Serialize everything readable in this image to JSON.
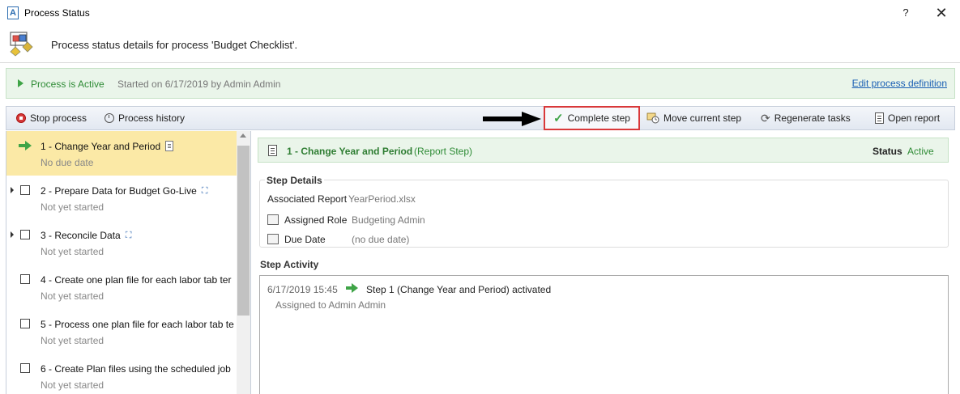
{
  "window": {
    "title": "Process Status",
    "app_icon_letter": "A",
    "help_label": "?",
    "close_label": "✕"
  },
  "header": {
    "description": "Process status details for process 'Budget Checklist'."
  },
  "status_bar": {
    "state_label": "Process is Active",
    "started_text": "Started on 6/17/2019 by Admin Admin",
    "edit_link": "Edit process definition",
    "accent_color": "#2e8b35"
  },
  "toolbar": {
    "stop_label": "Stop process",
    "history_label": "Process history",
    "complete_label": "Complete step",
    "move_label": "Move current step",
    "regenerate_label": "Regenerate tasks",
    "open_report_label": "Open report",
    "highlight_color": "#d9383a"
  },
  "steps": [
    {
      "title": "1 - Change Year and Period",
      "subtitle": "No due date",
      "icon": "document-icon",
      "selected": true
    },
    {
      "title": "2 - Prepare Data for Budget Go-Live",
      "subtitle": "Not yet started",
      "icon": "hierarchy-icon",
      "selected": false
    },
    {
      "title": "3 - Reconcile Data",
      "subtitle": "Not yet started",
      "icon": "hierarchy-icon",
      "selected": false
    },
    {
      "title": "4 - Create one plan file for each labor tab ter",
      "subtitle": "Not yet started",
      "icon": "",
      "selected": false
    },
    {
      "title": "5 - Process one plan file for each labor tab te",
      "subtitle": "Not yet started",
      "icon": "",
      "selected": false
    },
    {
      "title": "6 - Create Plan files using the scheduled job",
      "subtitle": "Not yet started",
      "icon": "",
      "selected": false
    }
  ],
  "step_header": {
    "title": "1 - Change Year and Period",
    "type": "(Report Step)",
    "status_label": "Status",
    "status_value": "Active"
  },
  "details": {
    "section_title": "Step Details",
    "report_label": "Associated Report",
    "report_value": "YearPeriod.xlsx",
    "role_label": "Assigned Role",
    "role_value": "Budgeting Admin",
    "due_label": "Due Date",
    "due_value": "(no due date)"
  },
  "activity": {
    "section_title": "Step Activity",
    "entries": [
      {
        "time": "6/17/2019 15:45",
        "text": "Step 1 (Change Year and Period) activated",
        "sub": "Assigned to Admin Admin"
      }
    ]
  }
}
